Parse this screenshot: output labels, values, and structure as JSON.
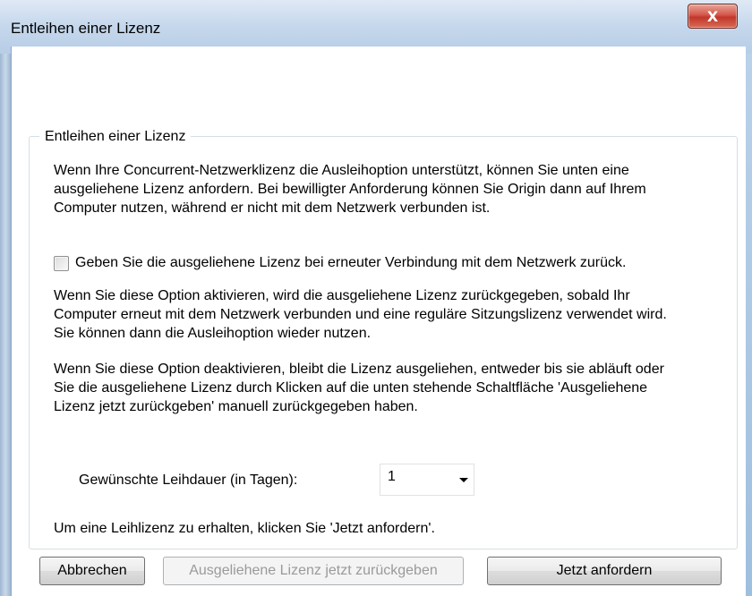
{
  "window": {
    "title": "Entleihen einer Lizenz",
    "close_glyph": "X"
  },
  "group": {
    "title": "Entleihen einer Lizenz"
  },
  "intro": {
    "lines": [
      "Wenn Ihre Concurrent-Netzwerklizenz die Ausleihoption unterstützt, können Sie unten eine",
      "ausgeliehene Lizenz anfordern. Bei bewilligter Anforderung können Sie Origin dann auf Ihrem",
      "Computer nutzen, während er nicht mit dem Netzwerk verbunden ist."
    ]
  },
  "checkbox": {
    "label": "Geben Sie die ausgeliehene Lizenz bei erneuter Verbindung mit dem Netzwerk zurück.",
    "checked": false
  },
  "option_on": {
    "lines": [
      "Wenn Sie diese Option aktivieren, wird die ausgeliehene Lizenz zurückgegeben, sobald Ihr",
      "Computer erneut mit dem Netzwerk verbunden und eine reguläre Sitzungslizenz verwendet wird.",
      "Sie können dann die Ausleihoption wieder nutzen."
    ]
  },
  "option_off": {
    "lines": [
      "Wenn Sie diese Option deaktivieren, bleibt die Lizenz ausgeliehen, entweder bis sie abläuft oder",
      "Sie die ausgeliehene Lizenz durch Klicken auf die unten stehende Schaltfläche 'Ausgeliehene",
      "Lizenz jetzt zurückgeben' manuell zurückgegeben haben."
    ]
  },
  "duration": {
    "label": "Gewünschte Leihdauer (in Tagen):",
    "value": "1"
  },
  "hint": "Um eine Leihlizenz zu erhalten, klicken Sie 'Jetzt anfordern'.",
  "buttons": {
    "cancel": "Abbrechen",
    "return_now": "Ausgeliehene Lizenz jetzt zurückgeben",
    "request_now": "Jetzt anfordern"
  }
}
